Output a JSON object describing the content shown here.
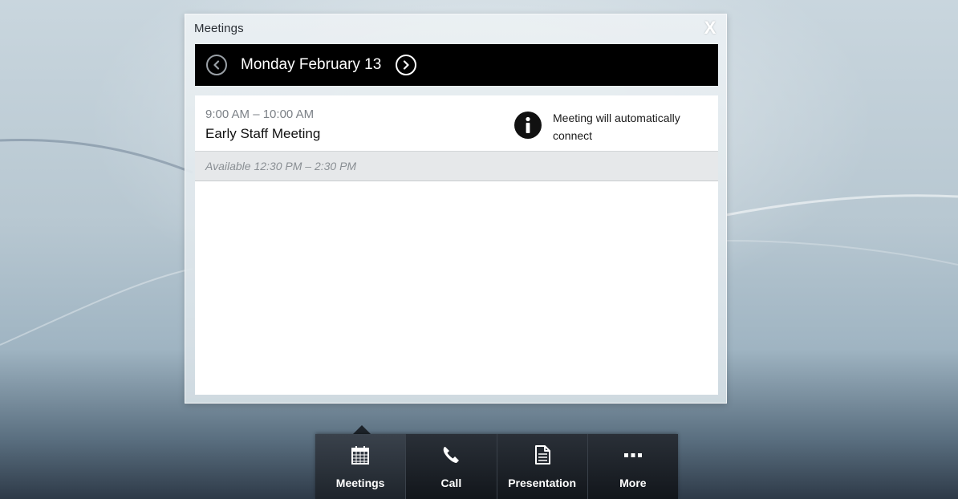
{
  "panel": {
    "title": "Meetings",
    "close_glyph": "X",
    "date_label": "Monday February 13",
    "prev_icon": "chevron-left-circle-icon",
    "next_icon": "chevron-right-circle-icon"
  },
  "meetings": [
    {
      "time": "9:00 AM – 10:00 AM",
      "name": "Early Staff Meeting",
      "info_icon": "info-icon",
      "note": "Meeting will automatically connect"
    }
  ],
  "available": {
    "text": "Available 12:30 PM – 2:30 PM"
  },
  "toolbar": {
    "items": [
      {
        "label": "Meetings",
        "icon": "calendar-icon",
        "active": true
      },
      {
        "label": "Call",
        "icon": "phone-icon",
        "active": false
      },
      {
        "label": "Presentation",
        "icon": "document-icon",
        "active": false
      },
      {
        "label": "More",
        "icon": "more-icon",
        "active": false
      }
    ]
  },
  "colors": {
    "date_bar_bg": "#000000",
    "toolbar_bg": "#1a1f25",
    "available_bg": "#e6e8ea"
  }
}
